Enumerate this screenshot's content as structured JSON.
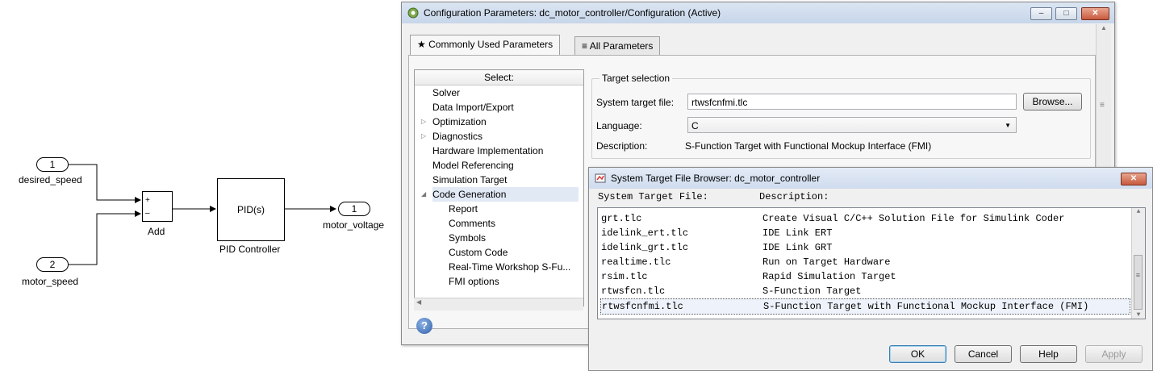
{
  "model": {
    "inport1": {
      "number": "1",
      "name": "desired_speed"
    },
    "inport2": {
      "number": "2",
      "name": "motor_speed"
    },
    "sum": {
      "sign1": "+",
      "sign2": "–",
      "name": "Add"
    },
    "pid": {
      "text": "PID(s)",
      "name": "PID Controller"
    },
    "outport": {
      "number": "1",
      "name": "motor_voltage"
    }
  },
  "config_dialog": {
    "title": "Configuration Parameters: dc_motor_controller/Configuration (Active)",
    "tabs": [
      {
        "label": "Commonly Used Parameters",
        "icon": "star-icon",
        "active": true
      },
      {
        "label": "All Parameters",
        "icon": "list-icon",
        "active": false
      }
    ],
    "tree": {
      "header": "Select:",
      "items": [
        {
          "label": "Solver"
        },
        {
          "label": "Data Import/Export"
        },
        {
          "label": "Optimization",
          "expandable": true
        },
        {
          "label": "Diagnostics",
          "expandable": true
        },
        {
          "label": "Hardware Implementation"
        },
        {
          "label": "Model Referencing"
        },
        {
          "label": "Simulation Target"
        },
        {
          "label": "Code Generation",
          "expanded": true,
          "selected": true
        },
        {
          "label": "Report",
          "child": true
        },
        {
          "label": "Comments",
          "child": true
        },
        {
          "label": "Symbols",
          "child": true
        },
        {
          "label": "Custom Code",
          "child": true
        },
        {
          "label": "Real-Time Workshop S-Fu...",
          "child": true
        },
        {
          "label": "FMI options",
          "child": true
        }
      ]
    },
    "target_selection": {
      "group_title": "Target selection",
      "system_target_file_label": "System target file:",
      "system_target_file_value": "rtwsfcnfmi.tlc",
      "browse_label": "Browse...",
      "language_label": "Language:",
      "language_value": "C",
      "description_label": "Description:",
      "description_value": "S-Function Target with Functional Mockup Interface (FMI)"
    }
  },
  "stf_browser": {
    "title": "System Target File Browser: dc_motor_controller",
    "col_file": "System Target File:",
    "col_desc": "Description:",
    "rows": [
      {
        "file": "grt.tlc",
        "desc": "Create Visual C/C++ Solution File for Simulink Coder"
      },
      {
        "file": "idelink_ert.tlc",
        "desc": "IDE Link ERT"
      },
      {
        "file": "idelink_grt.tlc",
        "desc": "IDE Link GRT"
      },
      {
        "file": "realtime.tlc",
        "desc": "Run on Target Hardware"
      },
      {
        "file": "rsim.tlc",
        "desc": "Rapid Simulation Target"
      },
      {
        "file": "rtwsfcn.tlc",
        "desc": "S-Function Target"
      },
      {
        "file": "rtwsfcnfmi.tlc",
        "desc": "S-Function Target with Functional Mockup Interface (FMI)",
        "selected": true
      }
    ],
    "buttons": {
      "ok": "OK",
      "cancel": "Cancel",
      "help": "Help",
      "apply": "Apply"
    }
  },
  "colors": {
    "titlebar": "#c7d6ea",
    "selection": "#e1e9f5",
    "close_button": "#c85a3d"
  }
}
